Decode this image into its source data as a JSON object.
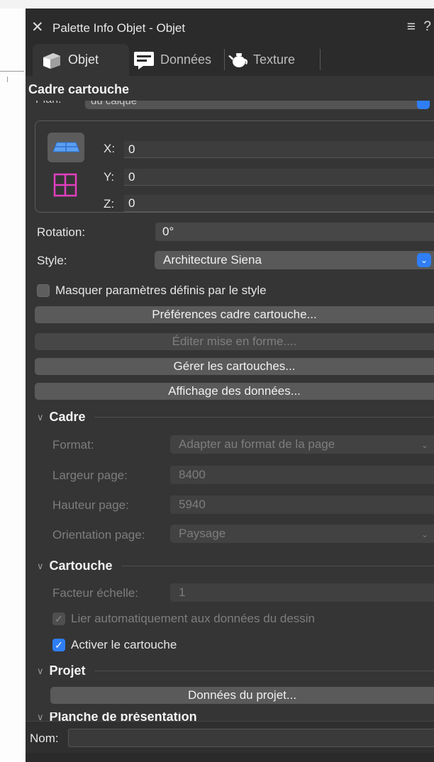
{
  "window": {
    "title": "Palette Info Objet - Objet",
    "close_icon": "close-icon",
    "menu_icon": "menu-icon",
    "help_label": "?"
  },
  "tabs": [
    {
      "label": "Objet",
      "icon": "object-icon",
      "active": true
    },
    {
      "label": "Données",
      "icon": "data-icon",
      "active": false
    },
    {
      "label": "Texture",
      "icon": "teapot-icon",
      "active": false
    }
  ],
  "section_title": "Cadre cartouche",
  "plan": {
    "label": "Plan:",
    "value": "du calque"
  },
  "coords": {
    "x_label": "X:",
    "x_value": "0",
    "y_label": "Y:",
    "y_value": "0",
    "z_label": "Z:",
    "z_value": "0"
  },
  "rotation": {
    "label": "Rotation:",
    "value": "0°"
  },
  "style": {
    "label": "Style:",
    "value": "Architecture Siena"
  },
  "hide_params": {
    "label": "Masquer paramètres définis par le style",
    "checked": false
  },
  "buttons": {
    "prefs": "Préférences cadre cartouche...",
    "edit_layout": "Éditer mise en forme....",
    "manage": "Gérer les cartouches...",
    "data_display": "Affichage des données..."
  },
  "cadre": {
    "title": "Cadre",
    "format_label": "Format:",
    "format_value": "Adapter au format de la page",
    "width_label": "Largeur page:",
    "width_value": "8400",
    "height_label": "Hauteur page:",
    "height_value": "5940",
    "orientation_label": "Orientation page:",
    "orientation_value": "Paysage"
  },
  "cartouche": {
    "title": "Cartouche",
    "scale_label": "Facteur échelle:",
    "scale_value": "1",
    "link_label": "Lier automatiquement aux données du dessin",
    "link_checked": true,
    "activate_label": "Activer le cartouche",
    "activate_checked": true
  },
  "projet": {
    "title": "Projet",
    "button": "Données du projet..."
  },
  "planche": {
    "title": "Planche de présentation"
  },
  "name": {
    "label": "Nom:",
    "value": ""
  },
  "colors": {
    "panel_bg": "#353535",
    "title_bg": "#2b2b2b",
    "accent_blue": "#2f7ef6",
    "magenta_icon": "#e23fbf",
    "blue_icon": "#5aa0f0"
  }
}
